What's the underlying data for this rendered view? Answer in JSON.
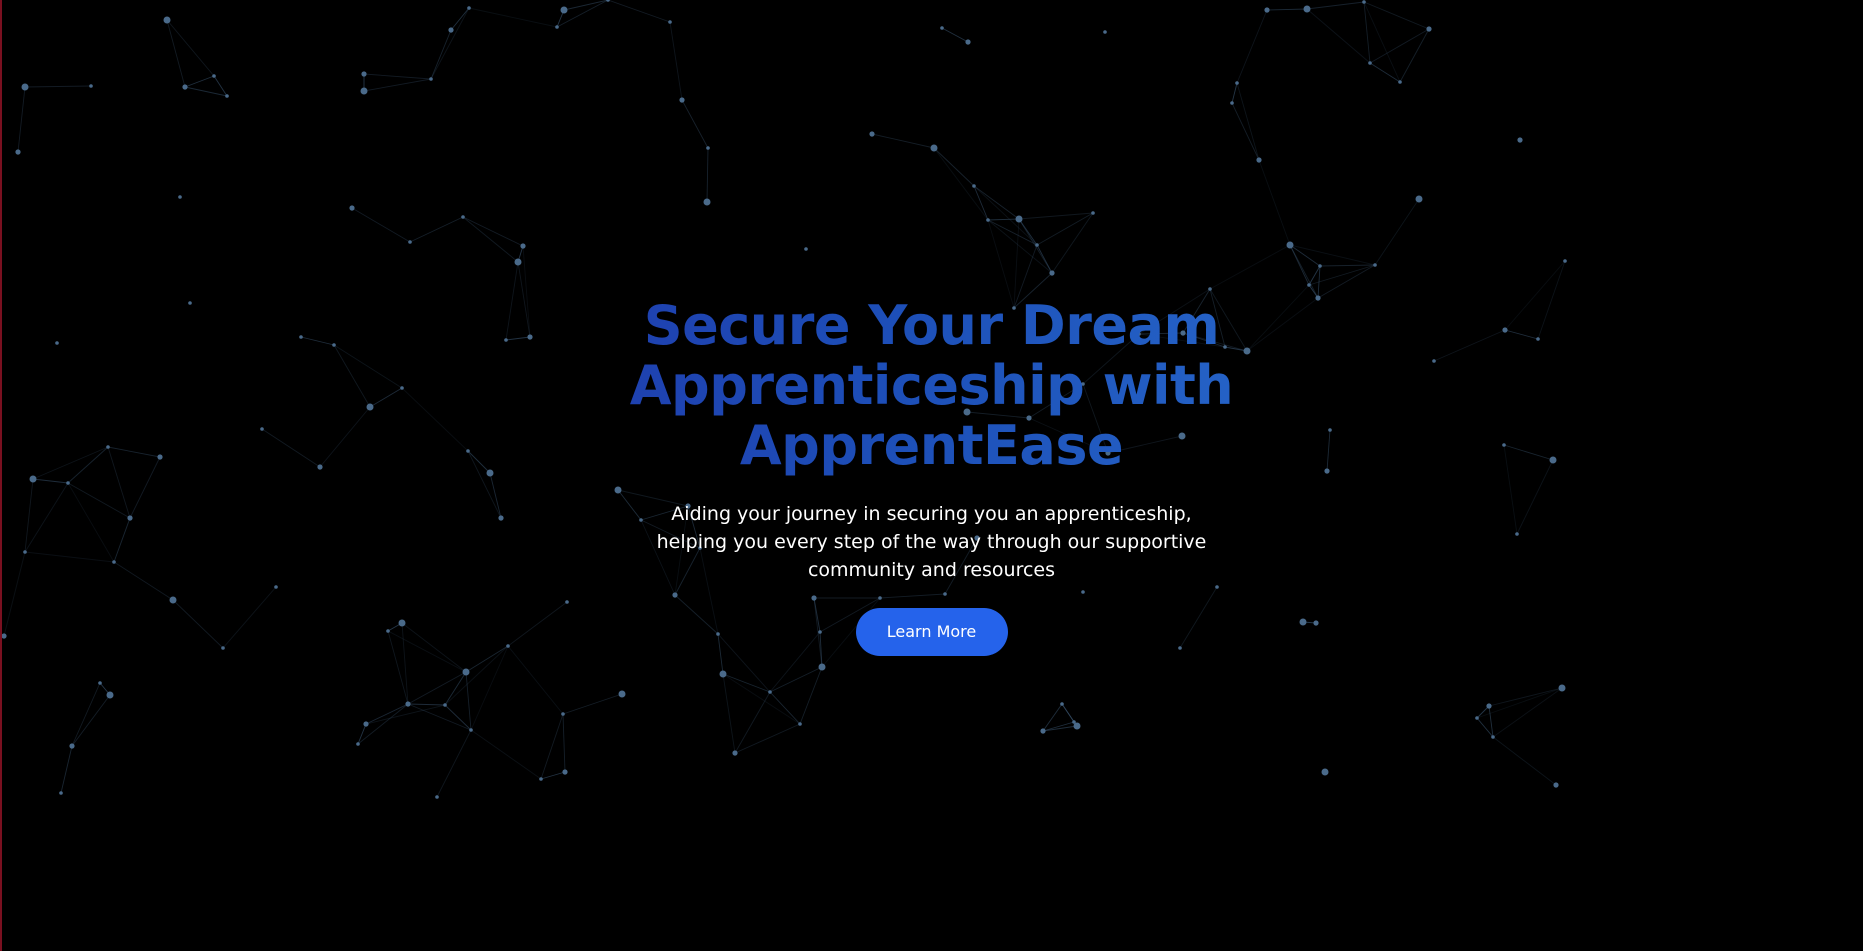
{
  "hero": {
    "title": "Secure Your Dream Apprenticeship with ApprentEase",
    "subtitle": "Aiding your journey in securing you an apprenticeship, helping you every step of the way through our supportive community and resources",
    "cta_label": "Learn More"
  },
  "colors": {
    "background": "#000000",
    "title_gradient_start": "#1e40af",
    "title_gradient_end": "#2563c7",
    "button": "#2563eb",
    "particle": "#4a6a8a"
  }
}
